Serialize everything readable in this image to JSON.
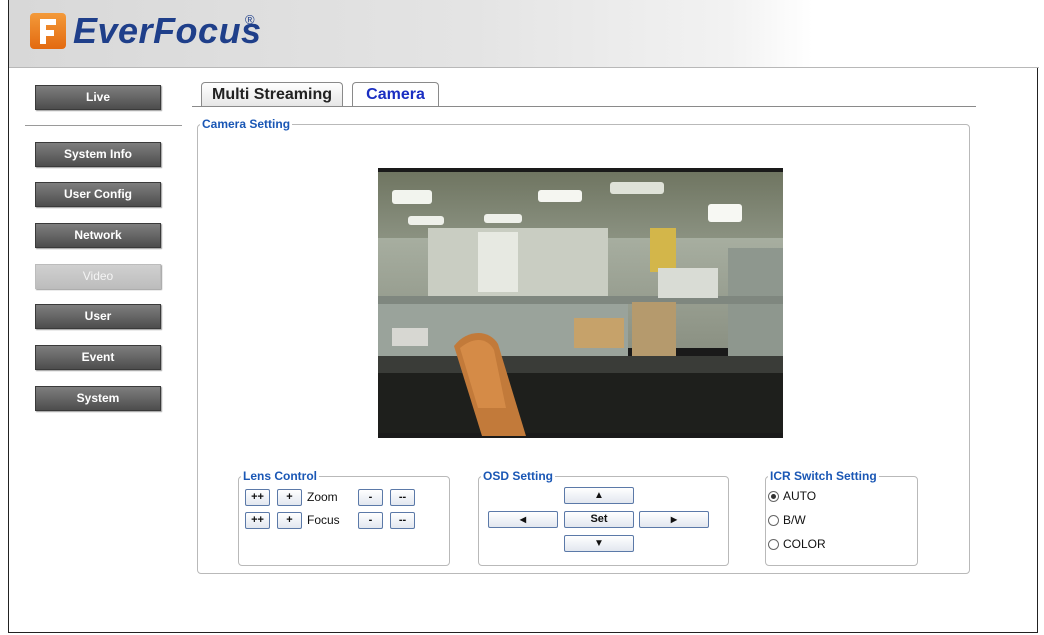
{
  "brand": {
    "name": "EverFocus",
    "reg": "®"
  },
  "nav": {
    "items": [
      {
        "label": "Live",
        "active": false
      },
      {
        "label": "System Info",
        "active": false
      },
      {
        "label": "User Config",
        "active": false
      },
      {
        "label": "Network",
        "active": false
      },
      {
        "label": "Video",
        "active": true
      },
      {
        "label": "User",
        "active": false
      },
      {
        "label": "Event",
        "active": false
      },
      {
        "label": "System",
        "active": false
      }
    ]
  },
  "tabs": [
    {
      "label": "Multi Streaming",
      "selected": false
    },
    {
      "label": "Camera",
      "selected": true
    }
  ],
  "camera_setting": {
    "legend": "Camera Setting"
  },
  "lens_control": {
    "legend": "Lens Control",
    "zoom_label": "Zoom",
    "focus_label": "Focus",
    "btn_fast_plus": "++",
    "btn_plus": "+",
    "btn_minus": "-",
    "btn_fast_minus": "--"
  },
  "osd_setting": {
    "legend": "OSD Setting",
    "up": "▲",
    "down": "▼",
    "left": "◀",
    "right": "▶",
    "set": "Set"
  },
  "icr_switch": {
    "legend": "ICR Switch Setting",
    "options": [
      {
        "label": "AUTO",
        "checked": true
      },
      {
        "label": "B/W",
        "checked": false
      },
      {
        "label": "COLOR",
        "checked": false
      }
    ]
  },
  "colors": {
    "accent_blue": "#1a57b5",
    "tab_active_text": "#1a2ec2",
    "logo_orange": "#e36a10",
    "logo_navy": "#1f3f8a"
  }
}
